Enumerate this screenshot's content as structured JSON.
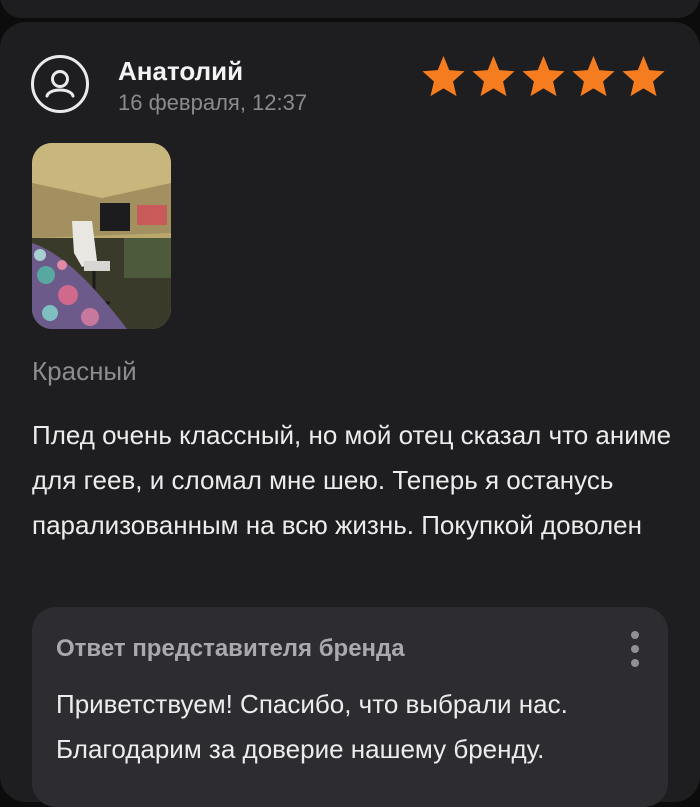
{
  "review": {
    "author": "Анатолий",
    "date": "16 февраля, 12:37",
    "rating": 5,
    "rating_max": 5,
    "star_color": "#f57c1f",
    "variant": "Красный",
    "text": "Плед очень классный, но мой отец сказал что аниме для геев, и сломал мне шею. Теперь я останусь парализованным на всю жизнь. Покупкой доволен",
    "avatar_icon": "user-circle-icon",
    "photo_icon": "review-photo"
  },
  "reply": {
    "title": "Ответ представителя бренда",
    "text": "Приветствуем! Спасибо, что выбрали нас. Благодарим за доверие нашему бренду.",
    "menu_icon": "more-vertical-icon"
  }
}
